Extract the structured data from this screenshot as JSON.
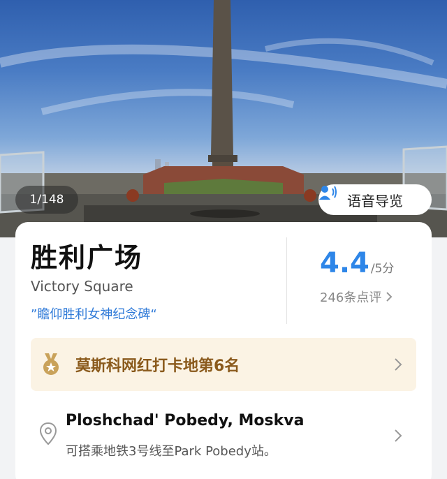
{
  "hero": {
    "counter": "1/148",
    "audio_guide_label": "语音导览",
    "audio_icon": "audio-guide-icon"
  },
  "poi": {
    "title": "胜利广场",
    "subtitle": "Victory Square",
    "tagline": "”瞻仰胜利女神纪念碑“",
    "rating": "4.4",
    "rating_unit": "/5分",
    "review_count": "246条点评"
  },
  "ranking": {
    "label": "莫斯科网红打卡地第6名",
    "icon": "medal-icon",
    "color": "#8a5a1c"
  },
  "location": {
    "name": "Ploshchad' Pobedy, Moskva",
    "transport": "可搭乘地铁3号线至Park Pobedy站。",
    "icon": "location-pin-icon"
  },
  "colors": {
    "accent": "#2e86e8",
    "rank_bg": "#fbf3e4"
  }
}
